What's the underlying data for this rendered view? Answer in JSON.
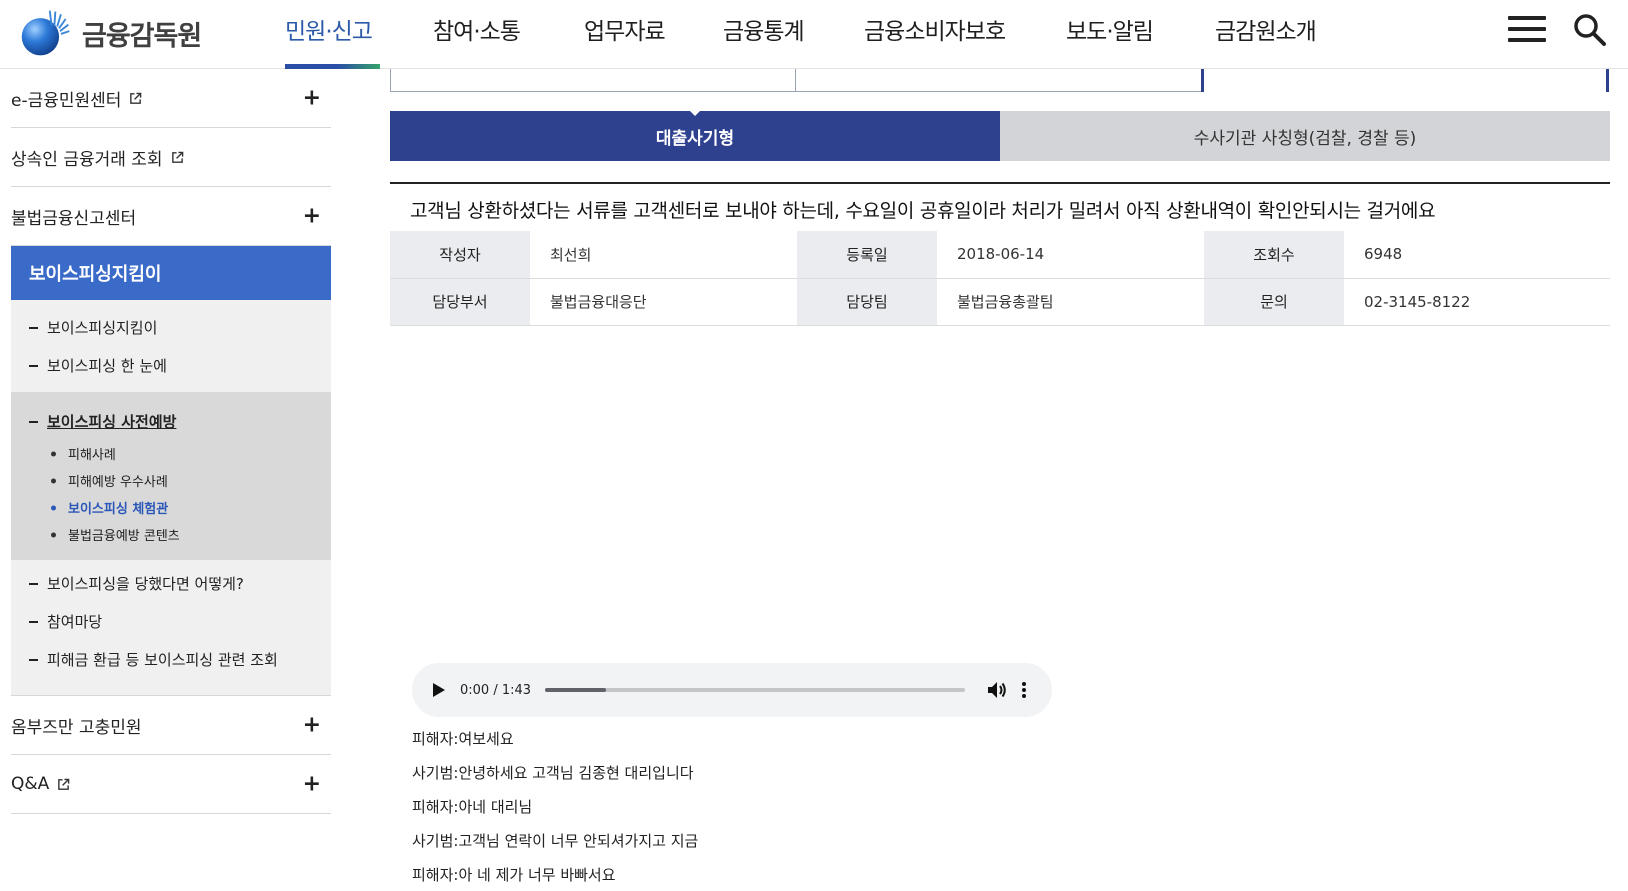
{
  "header": {
    "logo_text": "금융감독원",
    "nav": [
      {
        "label": "민원·신고",
        "active": true
      },
      {
        "label": "참여·소통"
      },
      {
        "label": "업무자료"
      },
      {
        "label": "금융통계"
      },
      {
        "label": "금융소비자보호"
      },
      {
        "label": "보도·알림"
      },
      {
        "label": "금감원소개"
      }
    ],
    "icons": [
      "hamburger-menu-icon",
      "search-icon"
    ]
  },
  "sidebar": {
    "items": [
      {
        "label": "e-금융민원센터",
        "external": true,
        "expand": "+"
      },
      {
        "label": "상속인 금융거래 조회",
        "external": true
      },
      {
        "label": "불법금융신고센터",
        "expand": "+"
      },
      {
        "label": "보이스피싱지킴이",
        "active": true
      },
      {
        "label": "옴부즈만 고충민원",
        "expand": "+"
      },
      {
        "label": "Q&A",
        "external": true,
        "expand": "+"
      }
    ],
    "sub_items": [
      {
        "label": "보이스피싱지킴이"
      },
      {
        "label": "보이스피싱 한 눈에"
      },
      {
        "label": "보이스피싱 사전예방",
        "current": true
      },
      {
        "label": "보이스피싱을 당했다면 어떻게?"
      },
      {
        "label": "참여마당"
      },
      {
        "label": "피해금 환급 등 보이스피싱 관련 조회"
      }
    ],
    "sub3_items": [
      {
        "label": "피해사례"
      },
      {
        "label": "피해예방 우수사례"
      },
      {
        "label": "보이스피싱 체험관",
        "on": true
      },
      {
        "label": "불법금융예방 콘텐츠"
      }
    ]
  },
  "main": {
    "segments": [
      {
        "label": "대출사기형",
        "active": true
      },
      {
        "label": "수사기관 사칭형(검찰, 경찰 등)"
      }
    ],
    "post_title": "고객님 상환하셨다는 서류를 고객센터로 보내야 하는데, 수요일이 공휴일이라 처리가 밀려서 아직 상환내역이 확인안되시는 걸거에요",
    "info": {
      "author_label": "작성자",
      "author": "최선희",
      "date_label": "등록일",
      "date": "2018-06-14",
      "views_label": "조회수",
      "views": "6948",
      "dept_label": "담당부서",
      "dept": "불법금융대응단",
      "team_label": "담당팀",
      "team": "불법금융총괄팀",
      "contact_label": "문의",
      "contact": "02-3145-8122"
    },
    "audio": {
      "time": "0:00 / 1:43",
      "progress": 0.145
    },
    "transcript": [
      "피해자:여보세요",
      "사기범:안녕하세요 고객님 김종현 대리입니다",
      "피해자:아네 대리님",
      "사기범:고객님 연락이 너무 안되셔가지고 지금",
      "피해자:아 네 제가 너무 바빠서요"
    ]
  }
}
